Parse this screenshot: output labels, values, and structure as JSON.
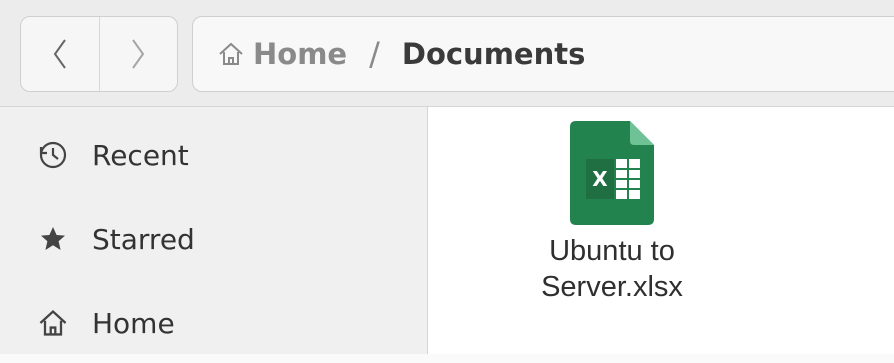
{
  "header": {
    "back_icon": "chevron-left-icon",
    "forward_icon": "chevron-right-icon",
    "breadcrumb": {
      "home_icon": "home-icon",
      "home_label": "Home",
      "separator": "/",
      "current_label": "Documents"
    }
  },
  "sidebar": {
    "items": [
      {
        "label": "Recent",
        "icon": "clock-icon"
      },
      {
        "label": "Starred",
        "icon": "star-icon"
      },
      {
        "label": "Home",
        "icon": "home-icon"
      }
    ]
  },
  "content": {
    "files": [
      {
        "name_line1": "Ubuntu to",
        "name_line2": "Server.xlsx",
        "icon": "spreadsheet-file-icon",
        "icon_color": "#2e8b57"
      }
    ]
  }
}
